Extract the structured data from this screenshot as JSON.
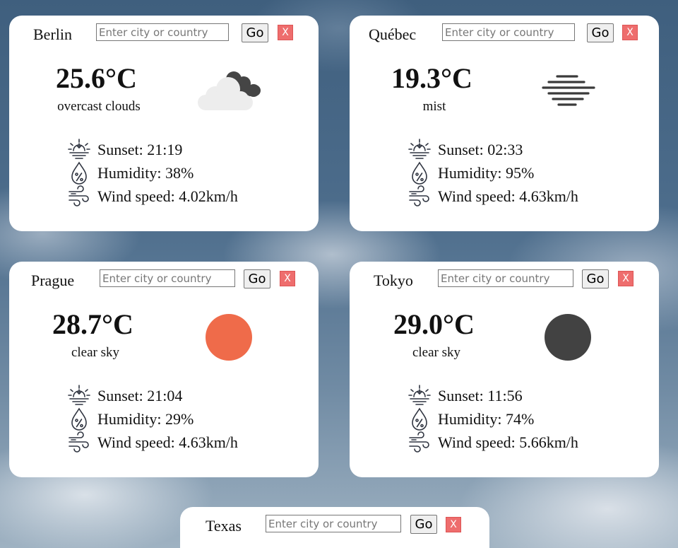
{
  "placeholder": "Enter city or country",
  "go_label": "Go",
  "close_label": "X",
  "cards": [
    {
      "city": "Berlin",
      "temp": "25.6°C",
      "desc": "overcast clouds",
      "icon": "overcast-clouds-icon",
      "sunset": "Sunset: 21:19",
      "humidity": "Humidity: 38%",
      "wind": "Wind speed: 4.02km/h"
    },
    {
      "city": "Québec",
      "temp": "19.3°C",
      "desc": "mist",
      "icon": "mist-icon",
      "sunset": "Sunset: 02:33",
      "humidity": "Humidity: 95%",
      "wind": "Wind speed: 4.63km/h"
    },
    {
      "city": "Prague",
      "temp": "28.7°C",
      "desc": "clear sky",
      "icon": "sun-icon",
      "sunset": "Sunset: 21:04",
      "humidity": "Humidity: 29%",
      "wind": "Wind speed: 4.63km/h"
    },
    {
      "city": "Tokyo",
      "temp": "29.0°C",
      "desc": "clear sky",
      "icon": "moon-icon",
      "sunset": "Sunset: 11:56",
      "humidity": "Humidity: 74%",
      "wind": "Wind speed: 5.66km/h"
    },
    {
      "city": "Texas"
    }
  ],
  "colors": {
    "sun": "#ef6b4a",
    "moon": "#424242",
    "close": "#ee6d6d",
    "icon_stroke": "#2f3440"
  }
}
